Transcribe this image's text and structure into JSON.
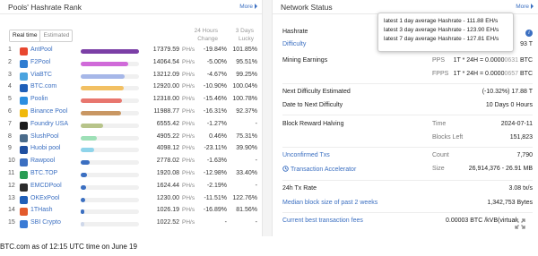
{
  "left_panel": {
    "title": "Pools' Hashrate Rank",
    "more": "More",
    "tabs": [
      "Real time",
      "Estimated"
    ],
    "col_change_line1": "24 Hours",
    "col_change_line2": "Change",
    "col_luck_line1": "3 Days",
    "col_luck_line2": "Lucky",
    "unit": "PH/s",
    "rows": [
      {
        "rank": "1",
        "name": "AntPool",
        "hashrate": "17379.59",
        "change": "-19.84%",
        "luck": "101.85%",
        "share": 1.0,
        "bar_color": "#7b3fa6",
        "icon_color": "#e8472f"
      },
      {
        "rank": "2",
        "name": "F2Pool",
        "hashrate": "14064.54",
        "change": "-5.00%",
        "luck": "95.51%",
        "share": 0.809,
        "bar_color": "#d06ad9",
        "icon_color": "#2f7dd1"
      },
      {
        "rank": "3",
        "name": "ViaBTC",
        "hashrate": "13212.09",
        "change": "-4.67%",
        "luck": "99.25%",
        "share": 0.76,
        "bar_color": "#a6b7e8",
        "icon_color": "#4aa3df"
      },
      {
        "rank": "4",
        "name": "BTC.com",
        "hashrate": "12920.00",
        "change": "-10.90%",
        "luck": "100.04%",
        "share": 0.743,
        "bar_color": "#f2c063",
        "icon_color": "#1f5fb8"
      },
      {
        "rank": "5",
        "name": "Poolin",
        "hashrate": "12318.00",
        "change": "-15.46%",
        "luck": "100.78%",
        "share": 0.709,
        "bar_color": "#e8766e",
        "icon_color": "#2b8ee0"
      },
      {
        "rank": "6",
        "name": "Binance Pool",
        "hashrate": "11988.77",
        "change": "-16.31%",
        "luck": "92.37%",
        "share": 0.69,
        "bar_color": "#c99763",
        "icon_color": "#f0b90b"
      },
      {
        "rank": "7",
        "name": "Foundry USA",
        "hashrate": "6555.42",
        "change": "-1.27%",
        "luck": "-",
        "share": 0.377,
        "bar_color": "#b7c48a",
        "icon_color": "#1a1a1a"
      },
      {
        "rank": "8",
        "name": "SlushPool",
        "hashrate": "4905.22",
        "change": "0.46%",
        "luck": "75.31%",
        "share": 0.282,
        "bar_color": "#9ee0b7",
        "icon_color": "#4a6b8a"
      },
      {
        "rank": "9",
        "name": "Huobi pool",
        "hashrate": "4098.12",
        "change": "-23.11%",
        "luck": "39.90%",
        "share": 0.236,
        "bar_color": "#8fd4ea",
        "icon_color": "#1f4fa0"
      },
      {
        "rank": "10",
        "name": "Rawpool",
        "hashrate": "2778.02",
        "change": "-1.63%",
        "luck": "-",
        "share": 0.16,
        "bar_color": "#3b6fc1",
        "icon_color": "#3b6fc1"
      },
      {
        "rank": "11",
        "name": "BTC.TOP",
        "hashrate": "1920.08",
        "change": "-12.98%",
        "luck": "33.40%",
        "share": 0.11,
        "bar_color": "#3b6fc1",
        "icon_color": "#2a9d54"
      },
      {
        "rank": "12",
        "name": "EMCDPool",
        "hashrate": "1624.44",
        "change": "-2.19%",
        "luck": "-",
        "share": 0.093,
        "bar_color": "#3b6fc1",
        "icon_color": "#2b2b2b"
      },
      {
        "rank": "13",
        "name": "OKExPool",
        "hashrate": "1230.00",
        "change": "-11.51%",
        "luck": "122.76%",
        "share": 0.071,
        "bar_color": "#3b6fc1",
        "icon_color": "#1f5fb8"
      },
      {
        "rank": "14",
        "name": "1THash",
        "hashrate": "1026.19",
        "change": "-16.89%",
        "luck": "81.56%",
        "share": 0.059,
        "bar_color": "#3b6fc1",
        "icon_color": "#e35b2c"
      },
      {
        "rank": "15",
        "name": "SBI Crypto",
        "hashrate": "1022.52",
        "change": "-",
        "luck": "-",
        "share": 0.059,
        "bar_color": "#cfd8ea",
        "icon_color": "#3a7bd5"
      }
    ]
  },
  "right_panel": {
    "title": "Network Status",
    "more": "More",
    "tooltip": [
      "latest 1 day average Hashrate - 111.88 EH/s",
      "latest 3 day average Hashrate - 123.90 EH/s",
      "latest 7 day average Hashrate - 127.81 EH/s"
    ],
    "hashrate_label": "Hashrate",
    "difficulty_label": "Difficulty",
    "difficulty_value_tail": "93 T",
    "mining_earnings_label": "Mining Earnings",
    "pps_label": "PPS",
    "pps_formula": "1T * 24H = 0.0000",
    "pps_gray": "0631",
    "pps_unit": "BTC",
    "fpps_label": "FPPS",
    "fpps_formula": "1T * 24H = 0.0000",
    "fpps_gray": "0657",
    "fpps_unit": "BTC",
    "next_diff_label": "Next Difficulty Estimated",
    "next_diff_value": "(-10.32%) 17.88 T",
    "date_next_diff_label": "Date to Next Difficulty",
    "date_next_diff_value": "10 Days 0 Hours",
    "halving_label": "Block Reward Halving",
    "time_label": "Time",
    "time_value": "2024-07-11",
    "blocks_left_label": "Blocks Left",
    "blocks_left_value": "151,823",
    "unconfirmed_label": "Unconfirmed Txs",
    "count_label": "Count",
    "count_value": "7,790",
    "accelerator_label": "Transaction Accelerator",
    "size_label": "Size",
    "size_value": "26,914,376 - 26.91 MB",
    "tx_rate_label": "24h Tx Rate",
    "tx_rate_value": "3.08 tx/s",
    "median_label": "Median block size of past 2 weeks",
    "median_value": "1,342,753 Bytes",
    "best_fees_label": "Current best transaction fees",
    "best_fees_value": "0.00003 BTC /kVB(virtual"
  },
  "footer": "BTC.com as of  12:15 UTC time on June 19"
}
